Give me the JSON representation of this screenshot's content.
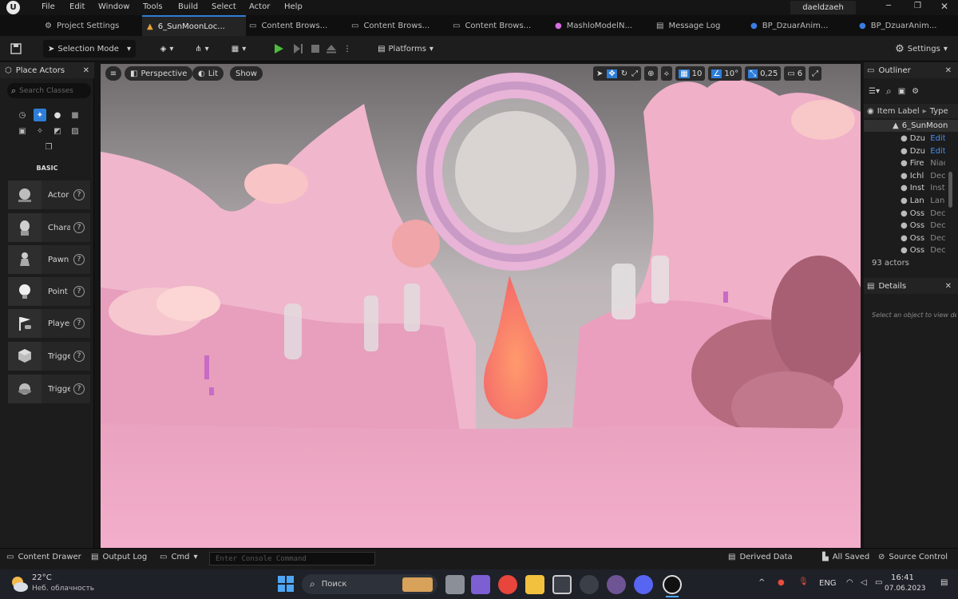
{
  "menu": {
    "items": [
      "File",
      "Edit",
      "Window",
      "Tools",
      "Build",
      "Select",
      "Actor",
      "Help"
    ],
    "user": "daeldzaeh"
  },
  "tabs": [
    {
      "label": "Project Settings"
    },
    {
      "label": "6_SunMoonLoc..."
    },
    {
      "label": "Content Brows..."
    },
    {
      "label": "Content Brows..."
    },
    {
      "label": "Content Brows..."
    },
    {
      "label": "MashloModelN..."
    },
    {
      "label": "Message Log"
    },
    {
      "label": "BP_DzuarAnim..."
    },
    {
      "label": "BP_DzuarAnim..."
    }
  ],
  "toolbar": {
    "selection_mode": "Selection Mode",
    "platforms": "Platforms",
    "settings": "Settings"
  },
  "place_actors": {
    "title": "Place Actors",
    "search_placeholder": "Search Classes",
    "category": "BASIC",
    "items": [
      "Actor",
      "Chara",
      "Pawn",
      "Point l",
      "Player",
      "Trigge",
      "Trigge"
    ]
  },
  "viewport": {
    "perspective": "Perspective",
    "lit": "Lit",
    "show": "Show",
    "grid": "10",
    "angle": "10°",
    "scale": "0,25",
    "camera": "6"
  },
  "outliner": {
    "title": "Outliner",
    "col_label": "Item Label",
    "col_type": "Type",
    "root": "6_SunMoon",
    "rows": [
      {
        "name": "Dzu",
        "type": "Edit"
      },
      {
        "name": "Dzu",
        "type": "Edit"
      },
      {
        "name": "Fire",
        "type": "Niac"
      },
      {
        "name": "Ichl",
        "type": "Dec"
      },
      {
        "name": "Inst",
        "type": "Inst"
      },
      {
        "name": "Lan",
        "type": "Lan"
      },
      {
        "name": "Oss",
        "type": "Dec"
      },
      {
        "name": "Oss",
        "type": "Dec"
      },
      {
        "name": "Oss",
        "type": "Dec"
      },
      {
        "name": "Oss",
        "type": "Dec"
      }
    ],
    "count": "93 actors"
  },
  "details": {
    "title": "Details",
    "empty_text": "Select an object to view de"
  },
  "bottom": {
    "content_drawer": "Content Drawer",
    "output_log": "Output Log",
    "cmd": "Cmd",
    "console_placeholder": "Enter Console Command",
    "derived_data": "Derived Data",
    "all_saved": "All Saved",
    "source_control": "Source Control"
  },
  "taskbar": {
    "temp": "22°C",
    "weather": "Неб. облачность",
    "search": "Поиск",
    "lang": "ENG",
    "time": "16:41",
    "date": "07.06.2023"
  },
  "colors": {
    "accent": "#2e7dd7",
    "play": "#4cbb3c",
    "viewport_sky": "#b9b1b3",
    "terrain_pink": "#f0a7c4"
  }
}
